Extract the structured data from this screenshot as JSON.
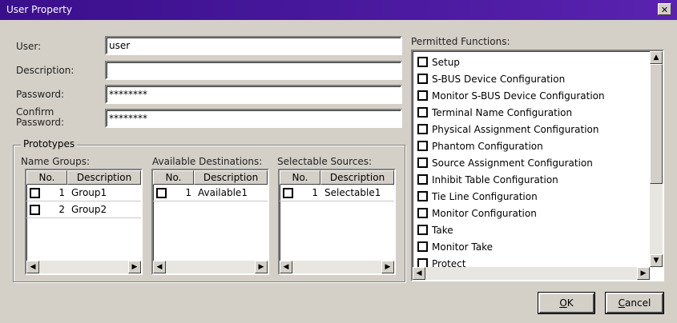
{
  "window": {
    "title": "User Property",
    "close_glyph": "✕"
  },
  "form": {
    "user_label": "User:",
    "user_value": "user",
    "description_label": "Description:",
    "description_value": "",
    "password_label": "Password:",
    "password_value": "********",
    "confirm_label_line1": "Confirm",
    "confirm_label_line2": "Password:",
    "confirm_value": "********"
  },
  "prototypes": {
    "title": "Prototypes",
    "name_groups": {
      "label": "Name Groups:",
      "col_no": "No.",
      "col_desc": "Description",
      "rows": [
        {
          "no": "1",
          "desc": "Group1"
        },
        {
          "no": "2",
          "desc": "Group2"
        }
      ]
    },
    "available_destinations": {
      "label": "Available Destinations:",
      "col_no": "No.",
      "col_desc": "Description",
      "rows": [
        {
          "no": "1",
          "desc": "Available1"
        }
      ]
    },
    "selectable_sources": {
      "label": "Selectable Sources:",
      "col_no": "No.",
      "col_desc": "Description",
      "rows": [
        {
          "no": "1",
          "desc": "Selectable1"
        }
      ]
    }
  },
  "permitted": {
    "label": "Permitted Functions:",
    "items": [
      "Setup",
      "S-BUS Device Configuration",
      "Monitor S-BUS Device Configuration",
      "Terminal Name Configuration",
      "Physical Assignment Configuration",
      "Phantom Configuration",
      "Source Assignment Configuration",
      "Inhibit Table Configuration",
      "Tie Line Configuration",
      "Monitor Configuration",
      "Take",
      "Monitor Take",
      "Protect"
    ]
  },
  "scroll": {
    "left": "◀",
    "right": "▶",
    "up": "▲",
    "down": "▼"
  },
  "buttons": {
    "ok_ul": "O",
    "ok_rest": "K",
    "cancel_ul": "C",
    "cancel_rest": "ancel"
  }
}
